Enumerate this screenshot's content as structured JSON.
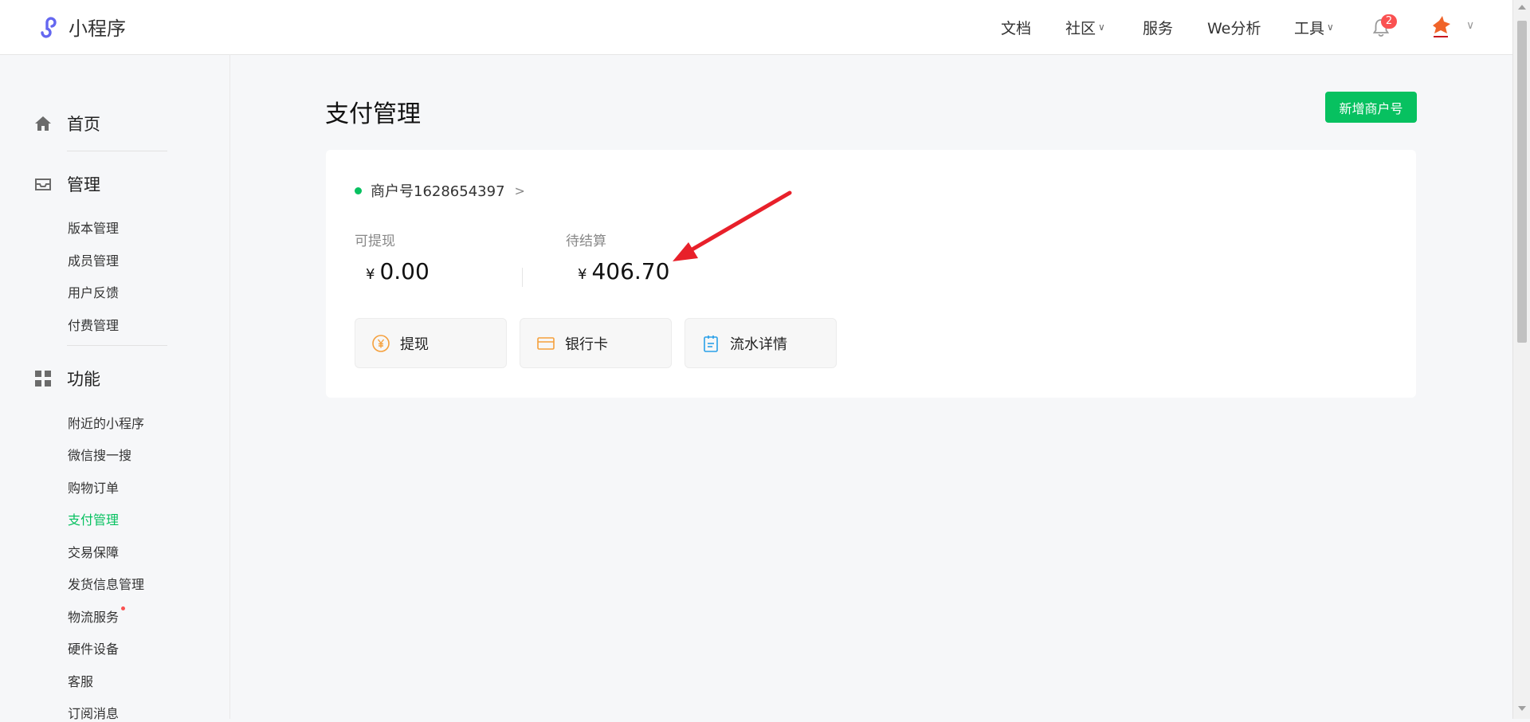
{
  "app": {
    "logo_text": "小程序"
  },
  "topnav": {
    "items": [
      {
        "label": "文档",
        "dropdown": false
      },
      {
        "label": "社区",
        "dropdown": true
      },
      {
        "label": "服务",
        "dropdown": false
      },
      {
        "label": "We分析",
        "dropdown": false
      },
      {
        "label": "工具",
        "dropdown": true
      }
    ],
    "notification_count": "2"
  },
  "sidebar": {
    "sections": [
      {
        "label": "首页",
        "icon": "home-icon"
      },
      {
        "label": "管理",
        "icon": "inbox-icon",
        "items": [
          "版本管理",
          "成员管理",
          "用户反馈",
          "付费管理"
        ]
      },
      {
        "label": "功能",
        "icon": "grid-icon",
        "items": [
          "附近的小程序",
          "微信搜一搜",
          "购物订单",
          "支付管理",
          "交易保障",
          "发货信息管理",
          "物流服务",
          "硬件设备",
          "客服",
          "订阅消息"
        ]
      }
    ],
    "active_item": "支付管理"
  },
  "main": {
    "title": "支付管理",
    "add_button": "新增商户号",
    "merchant": {
      "label": "商户号1628654397",
      "status_color": "#07c160"
    },
    "balances": [
      {
        "label": "可提现",
        "currency": "¥",
        "amount": "0.00"
      },
      {
        "label": "待结算",
        "currency": "¥",
        "amount": "406.70"
      }
    ],
    "actions": [
      {
        "label": "提现",
        "icon": "yuan-icon"
      },
      {
        "label": "银行卡",
        "icon": "bank-card-icon"
      },
      {
        "label": "流水详情",
        "icon": "clipboard-icon"
      }
    ]
  },
  "colors": {
    "primary": "#07c160",
    "badge": "#fa5151",
    "annotation": "#e8202a"
  }
}
